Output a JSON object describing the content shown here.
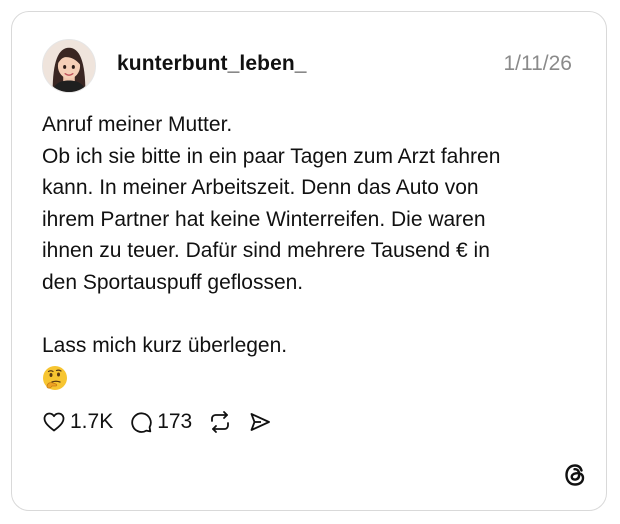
{
  "post": {
    "username": "kunterbunt_leben_",
    "date": "1/11/26",
    "lines": [
      "Anruf meiner Mutter.",
      "Ob ich sie bitte in ein paar Tagen zum Arzt fahren",
      "kann. In meiner Arbeitszeit. Denn das Auto von",
      "ihrem Partner hat keine Winterreifen. Die waren",
      "ihnen zu teuer. Dafür sind mehrere Tausend € in",
      "den Sportauspuff geflossen.",
      "Lass mich kurz überlegen."
    ],
    "emoji": "thinking-face"
  },
  "actions": {
    "likes": "1.7K",
    "replies": "173",
    "icons": [
      "heart-icon",
      "comment-icon",
      "repost-icon",
      "share-icon"
    ]
  },
  "branding": {
    "logo": "threads-logo-icon"
  }
}
